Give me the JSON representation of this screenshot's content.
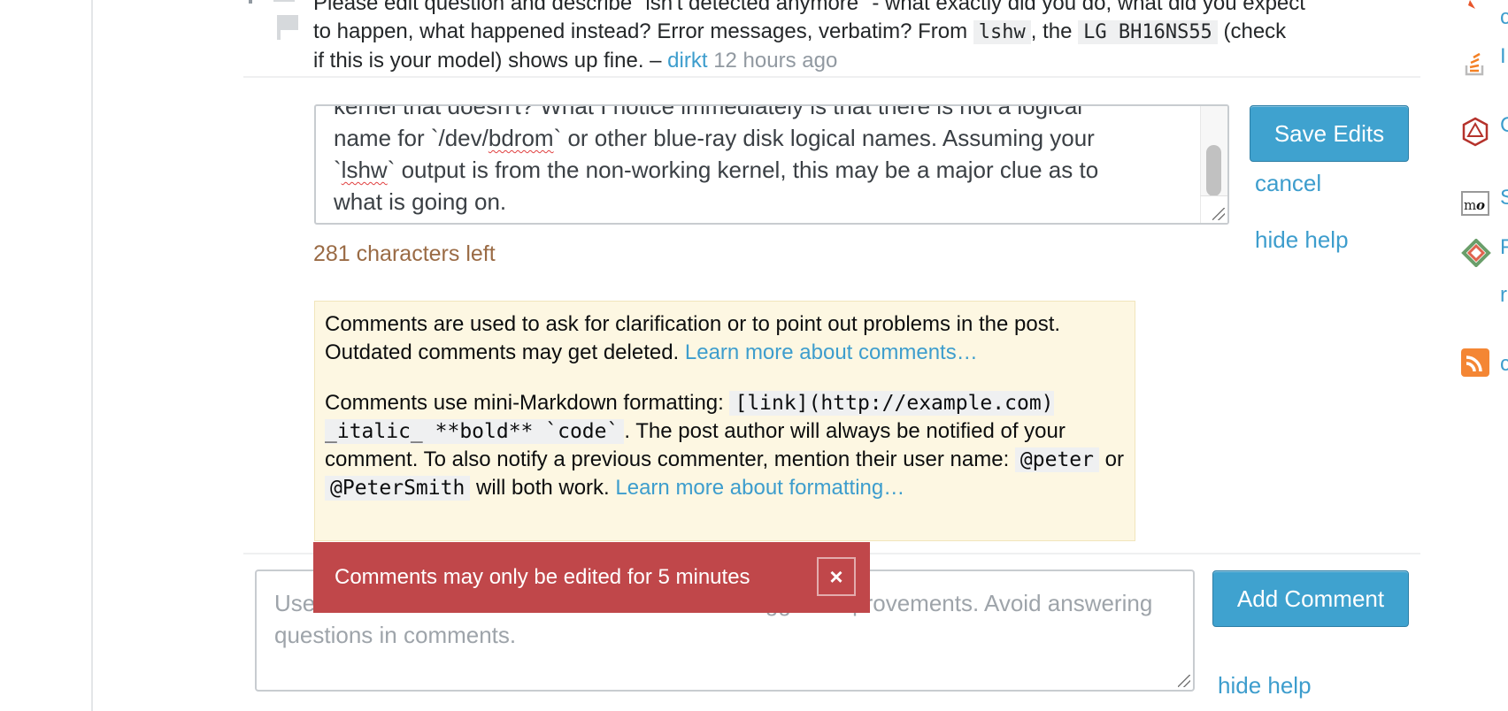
{
  "previous_comment": {
    "line0": "Please edit question and describe \"isn't detected anymore\" - what exactly did you do, what did you expect",
    "line1_a": "to happen, what happened instead? Error messages, verbatim? From ",
    "code1": "lshw",
    "line1_b": ", the ",
    "code2": "LG BH16NS55",
    "line1_c": " (check",
    "line2": "if this is your model) shows up fine. – ",
    "author": "dirkt",
    "timestamp": "12 hours ago"
  },
  "edit_comment": {
    "line0": "kernel that doesn't? What I notice immediately is that there is not a logical",
    "line1_a": "name for `/dev/",
    "line1_spell": "bdrom",
    "line1_b": "` or other blue-ray disk logical names. Assuming your",
    "line2_a": "`",
    "line2_spell": "lshw",
    "line2_b": "` output is from the non-working kernel, this may be a major clue as to",
    "line3": "what is going on.",
    "save_label": "Save Edits",
    "cancel_label": "cancel",
    "hide_help_label": "hide help",
    "chars_left": "281 characters left"
  },
  "help": {
    "p1": "Comments are used to ask for clarification or to point out problems in the post. Outdated comments may get deleted. ",
    "p1_link": "Learn more about comments…",
    "p2_a": "Comments use mini-Markdown formatting: ",
    "p2_code": "[link](http://example.com) _italic_ **bold** `code`",
    "p2_b": ". The post author will always be notified of your comment. To also notify a previous commenter, mention their user name: ",
    "p2_code2": "@peter",
    "p2_or": " or ",
    "p2_code3": "@PeterSmith",
    "p2_c": " will both work. ",
    "p2_link": "Learn more about formatting…"
  },
  "toast": {
    "message": "Comments may only be edited for 5 minutes",
    "close": "×"
  },
  "add_comment": {
    "placeholder": "Use comments to ask for more information or suggest improvements. Avoid answering questions in comments.",
    "button_label": "Add Comment",
    "hide_help_label": "hide help"
  },
  "sidebar": {
    "items": [
      {
        "icon": "flame-icon",
        "text": "c"
      },
      {
        "icon": "stackoverflow-icon",
        "text": "I"
      },
      {
        "icon": "rpg-d20-icon",
        "text": "C"
      },
      {
        "icon": "mathoverflow-icon",
        "text": "S"
      },
      {
        "icon": "codegolf-icon",
        "text": "F"
      },
      {
        "icon": "none",
        "text": "r"
      },
      {
        "icon": "rss-icon",
        "text": "c"
      }
    ]
  }
}
